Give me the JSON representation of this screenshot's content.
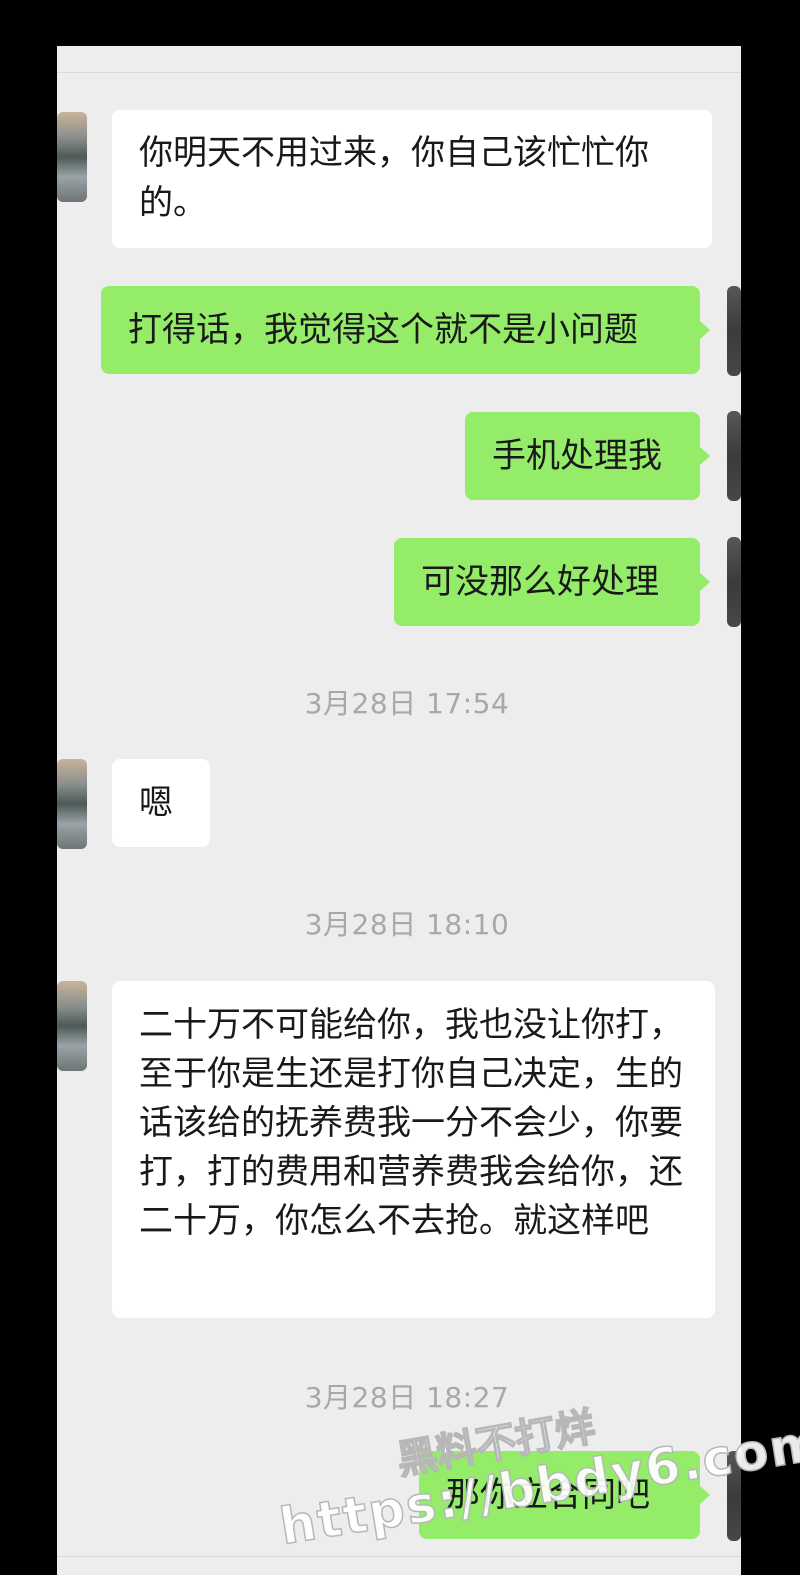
{
  "conversation": {
    "messages": [
      {
        "side": "received",
        "text": "你明天不用过来，你自己该忙忙你的。"
      },
      {
        "side": "sent",
        "text": "打得话，我觉得这个就不是小问题"
      },
      {
        "side": "sent",
        "text": "手机处理我"
      },
      {
        "side": "sent",
        "text": "可没那么好处理"
      },
      {
        "side": "received",
        "text": "嗯"
      },
      {
        "side": "received",
        "text": "二十万不可能给你，我也没让你打，至于你是生还是打你自己决定，生的话该给的抚养费我一分不会少，你要打，打的费用和营养费我会给你，还二十万，你怎么不去抢。就这样吧"
      },
      {
        "side": "sent",
        "text": "那你立合同吧"
      }
    ],
    "timestamps": [
      "3月28日 17:54",
      "3月28日 18:10",
      "3月28日 18:27"
    ]
  },
  "watermark": {
    "name": "黑料不打烊",
    "url": "https://bbdy6.com"
  },
  "colors": {
    "background": "#ededed",
    "sent_bubble": "#95ec69",
    "received_bubble": "#ffffff",
    "timestamp_text": "#a8a8a8"
  },
  "icons": [
    "contact-avatar",
    "self-avatar"
  ]
}
